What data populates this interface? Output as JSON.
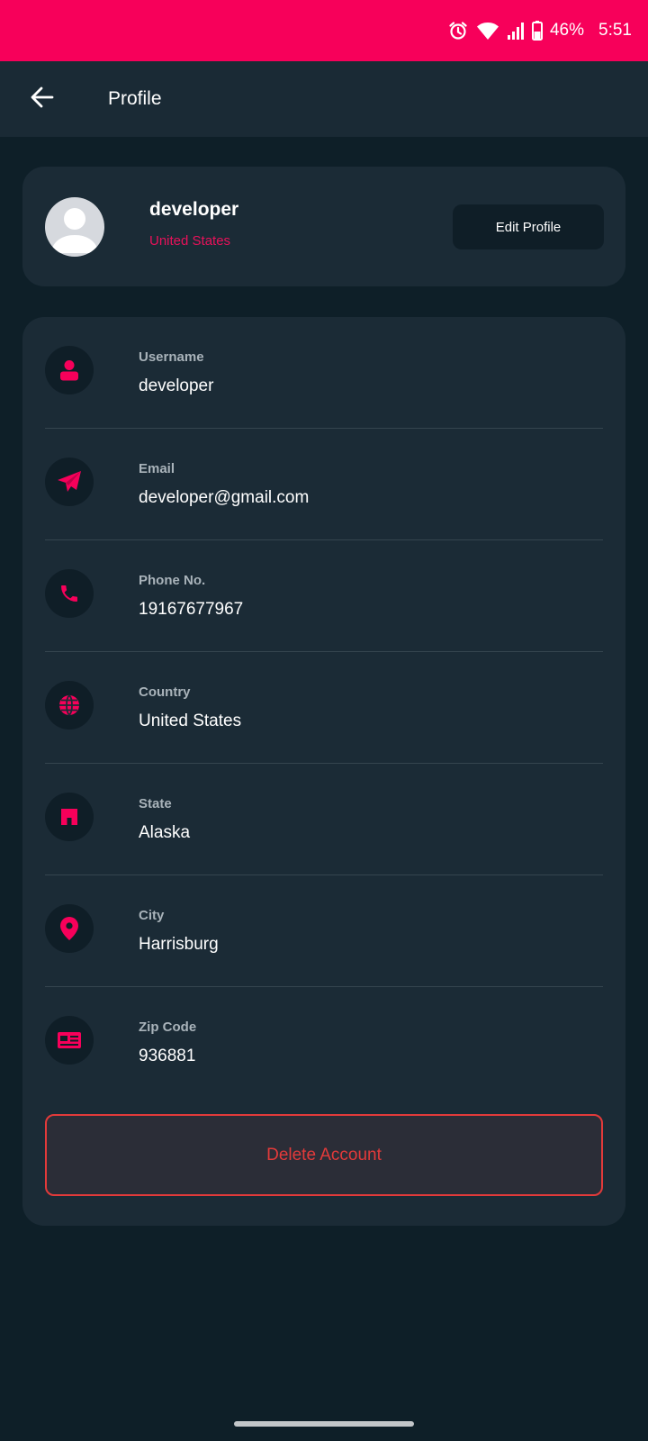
{
  "status_bar": {
    "battery": "46%",
    "time": "5:51",
    "icons": [
      "alarm-icon",
      "wifi-icon",
      "signal-icon",
      "battery-icon"
    ]
  },
  "app_bar": {
    "title": "Profile",
    "back_icon": "arrow-left-icon"
  },
  "profile": {
    "name": "developer",
    "country": "United States",
    "edit_label": "Edit Profile"
  },
  "details": [
    {
      "label": "Username",
      "value": "developer",
      "icon": "user-icon"
    },
    {
      "label": "Email",
      "value": "developer@gmail.com",
      "icon": "paper-plane-icon"
    },
    {
      "label": "Phone No.",
      "value": "19167677967",
      "icon": "phone-icon"
    },
    {
      "label": "Country",
      "value": "United States",
      "icon": "globe-icon"
    },
    {
      "label": "State",
      "value": "Alaska",
      "icon": "building-icon"
    },
    {
      "label": "City",
      "value": "Harrisburg",
      "icon": "map-pin-icon"
    },
    {
      "label": "Zip Code",
      "value": "936881",
      "icon": "id-card-icon"
    }
  ],
  "delete_label": "Delete Account",
  "colors": {
    "accent": "#f7005a",
    "background": "#0e1f28",
    "card": "#1b2b36",
    "danger": "#e23a3a"
  }
}
